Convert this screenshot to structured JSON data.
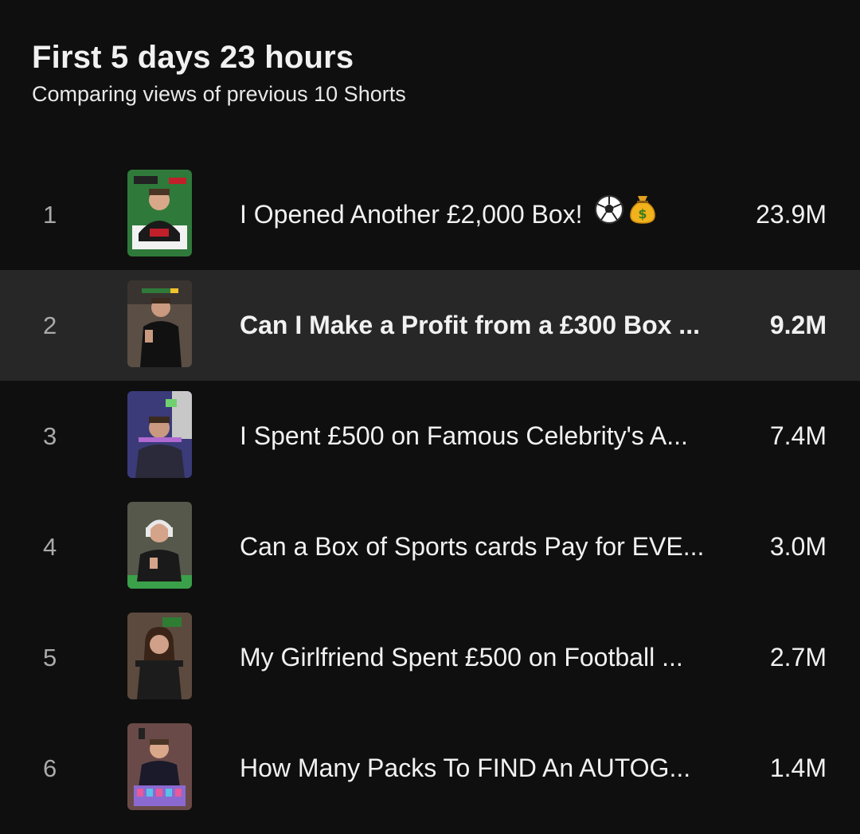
{
  "header": {
    "title": "First 5 days 23 hours",
    "subtitle": "Comparing views of previous 10 Shorts"
  },
  "shorts": [
    {
      "rank": "1",
      "title": "I Opened Another £2,000 Box!",
      "views": "23.9M",
      "thumb_colors": {
        "bg": "#2f7a3a",
        "shirt": "#1a1a1a",
        "skin": "#d9a88a",
        "accent": "#c0202a"
      }
    },
    {
      "rank": "2",
      "title": "Can I Make a Profit from a £300 Box ...",
      "views": "9.2M",
      "thumb_colors": {
        "bg": "#5a4e45",
        "shirt": "#111111",
        "skin": "#c99a80",
        "accent": "#e8e8e8"
      }
    },
    {
      "rank": "3",
      "title": "I Spent £500 on Famous Celebrity's A...",
      "views": "7.4M",
      "thumb_colors": {
        "bg": "#3b3b7a",
        "shirt": "#2a2a3a",
        "skin": "#c99a80",
        "accent": "#6fd16f"
      }
    },
    {
      "rank": "4",
      "title": "Can a Box of Sports cards Pay for EVE...",
      "views": "3.0M",
      "thumb_colors": {
        "bg": "#55584a",
        "shirt": "#1a1a1a",
        "skin": "#d4a48a",
        "accent": "#3aa04a"
      }
    },
    {
      "rank": "5",
      "title": "My Girlfriend Spent £500 on Football ...",
      "views": "2.7M",
      "thumb_colors": {
        "bg": "#5c4a3e",
        "shirt": "#1c1c1c",
        "skin": "#d0a088",
        "accent": "#2e7d32"
      }
    },
    {
      "rank": "6",
      "title": "How Many Packs To FIND An AUTOG...",
      "views": "1.4M",
      "thumb_colors": {
        "bg": "#6a4a48",
        "shirt": "#1a1a2a",
        "skin": "#d9a88a",
        "accent": "#8a6ad0"
      }
    }
  ],
  "emoji_icons": [
    "soccer-ball-icon",
    "money-bag-icon"
  ]
}
